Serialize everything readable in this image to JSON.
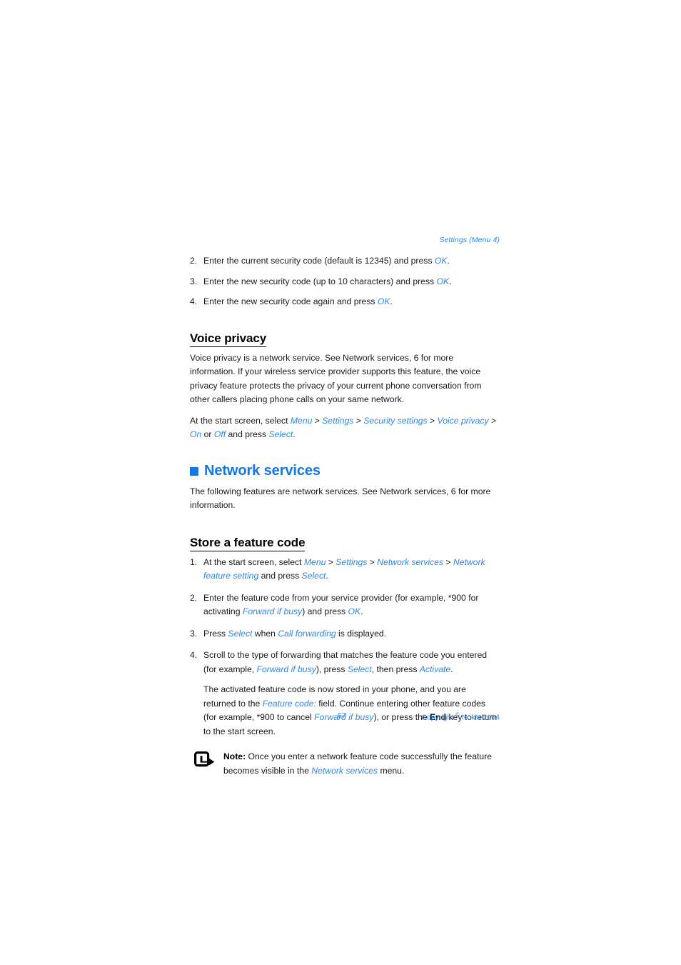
{
  "running_head": "Settings (Menu 4)",
  "security_steps": [
    {
      "num": "2.",
      "parts": [
        {
          "t": "Enter the current security code (default is 12345) and press ",
          "s": "plain"
        },
        {
          "t": "OK",
          "s": "link"
        },
        {
          "t": ".",
          "s": "plain"
        }
      ]
    },
    {
      "num": "3.",
      "parts": [
        {
          "t": "Enter the new security code (up to 10 characters) and press ",
          "s": "plain"
        },
        {
          "t": "OK",
          "s": "link"
        },
        {
          "t": ".",
          "s": "plain"
        }
      ]
    },
    {
      "num": "4.",
      "parts": [
        {
          "t": "Enter the new security code again and press ",
          "s": "plain"
        },
        {
          "t": "OK",
          "s": "link"
        },
        {
          "t": ".",
          "s": "plain"
        }
      ]
    }
  ],
  "voice_privacy": {
    "heading": "Voice privacy",
    "paragraph": "Voice privacy is a network service. See Network services, 6 for more information. If your wireless service provider supports this feature, the voice privacy feature protects the privacy of your current phone conversation from other callers placing phone calls on your same network.",
    "path_parts": [
      {
        "t": "At the start screen, select ",
        "s": "plain"
      },
      {
        "t": "Menu",
        "s": "link"
      },
      {
        "t": " > ",
        "s": "plain"
      },
      {
        "t": "Settings",
        "s": "link"
      },
      {
        "t": " > ",
        "s": "plain"
      },
      {
        "t": "Security settings",
        "s": "link"
      },
      {
        "t": " > ",
        "s": "plain"
      },
      {
        "t": "Voice privacy",
        "s": "link"
      },
      {
        "t": " > ",
        "s": "plain"
      },
      {
        "t": "On",
        "s": "link"
      },
      {
        "t": " or ",
        "s": "plain"
      },
      {
        "t": "Off",
        "s": "link"
      },
      {
        "t": " and press ",
        "s": "plain"
      },
      {
        "t": "Select",
        "s": "link"
      },
      {
        "t": ".",
        "s": "plain"
      }
    ]
  },
  "network_services": {
    "heading": "Network services",
    "square_color": "#1277e6",
    "intro": "The following features are network services. See Network services, 6 for more information."
  },
  "store_feature_code": {
    "heading": "Store a feature code",
    "steps": [
      {
        "num": "1.",
        "parts": [
          {
            "t": "At the start screen, select ",
            "s": "plain"
          },
          {
            "t": "Menu",
            "s": "link"
          },
          {
            "t": " > ",
            "s": "plain"
          },
          {
            "t": "Settings",
            "s": "link"
          },
          {
            "t": " > ",
            "s": "plain"
          },
          {
            "t": "Network services",
            "s": "link"
          },
          {
            "t": " > ",
            "s": "plain"
          },
          {
            "t": "Network feature setting",
            "s": "link"
          },
          {
            "t": " and press ",
            "s": "plain"
          },
          {
            "t": "Select",
            "s": "link"
          },
          {
            "t": ".",
            "s": "plain"
          }
        ]
      },
      {
        "num": "2.",
        "parts": [
          {
            "t": "Enter the feature code from your service provider (for example, *900 for activating ",
            "s": "plain"
          },
          {
            "t": "Forward if busy",
            "s": "link"
          },
          {
            "t": ") and press ",
            "s": "plain"
          },
          {
            "t": "OK",
            "s": "link"
          },
          {
            "t": ".",
            "s": "plain"
          }
        ]
      },
      {
        "num": "3.",
        "parts": [
          {
            "t": "Press ",
            "s": "plain"
          },
          {
            "t": "Select",
            "s": "link"
          },
          {
            "t": " when ",
            "s": "plain"
          },
          {
            "t": "Call forwarding",
            "s": "link"
          },
          {
            "t": " is displayed.",
            "s": "plain"
          }
        ]
      },
      {
        "num": "4.",
        "parts": [
          {
            "t": "Scroll to the type of forwarding that matches the feature code you entered (for example, ",
            "s": "plain"
          },
          {
            "t": "Forward if busy",
            "s": "link"
          },
          {
            "t": "), press ",
            "s": "plain"
          },
          {
            "t": "Select",
            "s": "link"
          },
          {
            "t": ", then press ",
            "s": "plain"
          },
          {
            "t": "Activate",
            "s": "link"
          },
          {
            "t": ".",
            "s": "plain"
          }
        ]
      }
    ],
    "step4_continuation": [
      {
        "t": "The activated feature code is now stored in your phone, and you are returned to the ",
        "s": "plain"
      },
      {
        "t": "Feature code:",
        "s": "link"
      },
      {
        "t": " field. Continue entering other feature codes (for example, *900 to cancel ",
        "s": "plain"
      },
      {
        "t": "Forward if busy",
        "s": "link"
      },
      {
        "t": "), or press the ",
        "s": "plain"
      },
      {
        "t": "End",
        "s": "bold"
      },
      {
        "t": " key to return to the start screen.",
        "s": "plain"
      }
    ],
    "note": [
      {
        "t": "Note:",
        "s": "bold"
      },
      {
        "t": " Once you enter a network feature code successfully the feature becomes visible in the ",
        "s": "plain"
      },
      {
        "t": "Network services",
        "s": "link"
      },
      {
        "t": " menu.",
        "s": "plain"
      }
    ],
    "note_icon": "note-arrow-icon"
  },
  "footer": {
    "page_number": "67",
    "copyright_prefix": "Copyright ",
    "copyright_symbol": "©",
    "copyright_suffix": " Nokia 2004"
  },
  "colors": {
    "link_blue": "#2f86e8",
    "heading_blue": "#1277e6",
    "footer_blue": "#3d8de8",
    "text_black": "#1a1a1a"
  }
}
